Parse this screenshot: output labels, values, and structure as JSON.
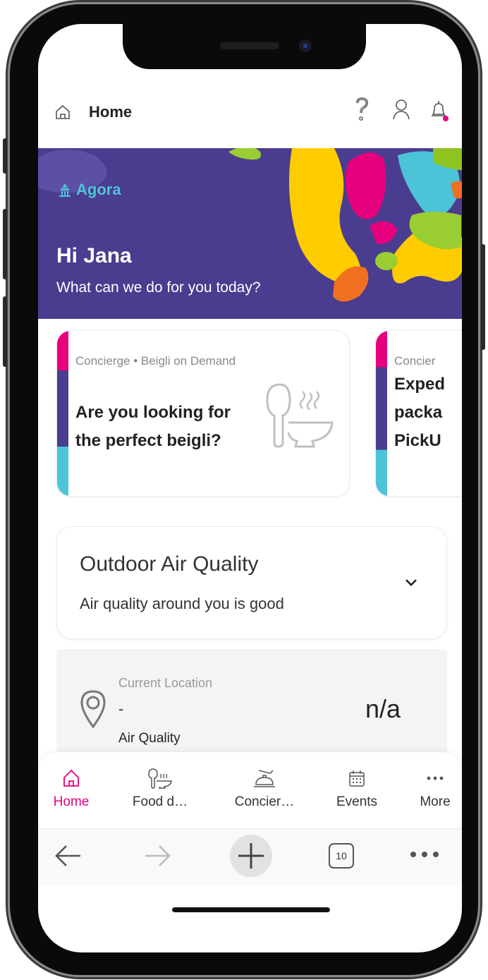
{
  "header": {
    "title": "Home"
  },
  "banner": {
    "brand": "Agora",
    "greeting": "Hi Jana",
    "subtitle": "What can we do for you today?"
  },
  "cards": [
    {
      "category": "Concierge • Beigli on Demand",
      "title": "Are you looking for the perfect beigli?",
      "icon": "food-delivery-icon"
    },
    {
      "category": "Concier",
      "title": "Exped packa PickU",
      "icon": ""
    }
  ],
  "air_quality": {
    "title": "Outdoor Air Quality",
    "subtitle": "Air quality around you is good",
    "location_label": "Current Location",
    "location_value": "-",
    "value": "n/a",
    "value_label": "Air Quality"
  },
  "bottom_nav": [
    {
      "label": "Home",
      "icon": "home-icon",
      "active": true
    },
    {
      "label": "Food d…",
      "icon": "food-delivery-icon",
      "active": false
    },
    {
      "label": "Concier…",
      "icon": "concierge-bell-icon",
      "active": false
    },
    {
      "label": "Events",
      "icon": "calendar-icon",
      "active": false
    },
    {
      "label": "More",
      "icon": "more-dots-icon",
      "active": false
    }
  ],
  "browser": {
    "tab_count": "10"
  },
  "colors": {
    "accent": "#e6007e",
    "banner": "#4a3d8f",
    "brand": "#4dc3d8"
  }
}
